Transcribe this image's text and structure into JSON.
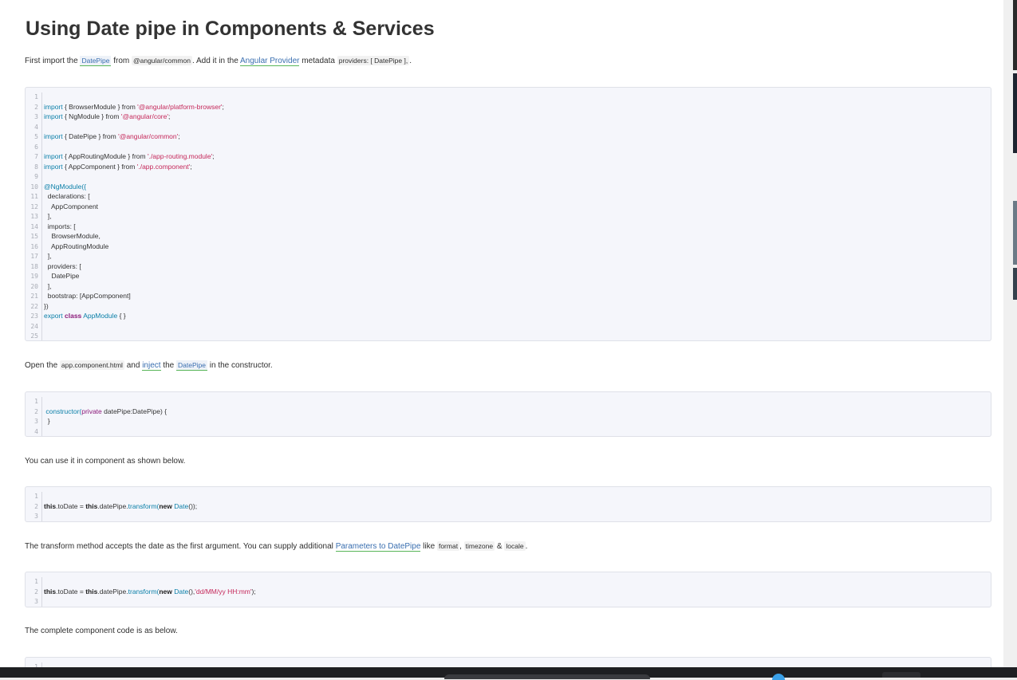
{
  "article": {
    "title": "Using Date pipe in Components & Services",
    "p1": {
      "t1": "First import the ",
      "link1": "DatePipe",
      "t2": " from ",
      "code1": "@angular/common",
      "t3": ". Add it in the ",
      "link2": "Angular Provider",
      "t4": " metadata ",
      "code2": "providers: [ DatePipe ],",
      "t5": "."
    },
    "p2": {
      "t1": "Open the ",
      "code1": "app.component.html",
      "t2": " and ",
      "link1": "inject",
      "t3": " the ",
      "link2": "DatePipe",
      "t4": " in the constructor."
    },
    "p3": {
      "t1": "You can use it in component as shown below."
    },
    "p4": {
      "t1": "The transform method accepts the date as the first argument. You can supply additional ",
      "link1": "Parameters to DatePipe",
      "t2": " like ",
      "code1": "format",
      "t3": ", ",
      "code2": "timezone",
      "t4": " & ",
      "code3": "locale",
      "t5": "."
    },
    "p5": {
      "t1": "The complete component code is as below."
    }
  },
  "code1": {
    "line_numbers": [
      "1",
      "2",
      "3",
      "4",
      "5",
      "6",
      "7",
      "8",
      "9",
      "10",
      "11",
      "12",
      "13",
      "14",
      "15",
      "16",
      "17",
      "18",
      "19",
      "20",
      "21",
      "22",
      "23",
      "24",
      "25"
    ],
    "l2": {
      "kw": "import",
      "a": " { BrowserModule } from ",
      "s": "'@angular/platform-browser'",
      "e": ";"
    },
    "l3": {
      "kw": "import",
      "a": " { NgModule } from ",
      "s": "'@angular/core'",
      "e": ";"
    },
    "l5": {
      "kw": "import",
      "a": " { DatePipe } from ",
      "s": "'@angular/common'",
      "e": ";"
    },
    "l7": {
      "kw": "import",
      "a": " { AppRoutingModule } from ",
      "s": "'./app-routing.module'",
      "e": ";"
    },
    "l8": {
      "kw": "import",
      "a": " { AppComponent } from ",
      "s": "'./app.component'",
      "e": ";"
    },
    "l10": {
      "kw": "@NgModule({"
    },
    "l11": "  declarations: [",
    "l12": "    AppComponent",
    "l13": "  ],",
    "l14": "  imports: [",
    "l15": "    BrowserModule,",
    "l16": "    AppRoutingModule",
    "l17": "  ],",
    "l18": "  providers: [",
    "l19": "    DatePipe",
    "l20": "  ],",
    "l21": "  bootstrap: [AppComponent]",
    "l22": "})",
    "l23": {
      "kw": "export",
      "b": "class",
      "n": "AppModule",
      "e": " { }"
    }
  },
  "code2": {
    "line_numbers": [
      "1",
      "2",
      "3",
      "4"
    ],
    "l2": {
      "fn": "constructor(",
      "kw": "private",
      "a": " datePipe:DatePipe) {"
    },
    "l3": "  }"
  },
  "code3": {
    "line_numbers": [
      "1",
      "2",
      "3"
    ],
    "l2": {
      "b1": "this",
      "a": ".toDate = ",
      "b2": "this",
      "c": ".datePipe.",
      "fn": "transform(",
      "b3": "new",
      "d": " ",
      "fn2": "Date",
      "e": "());"
    }
  },
  "code4": {
    "line_numbers": [
      "1",
      "2",
      "3"
    ],
    "l2": {
      "b1": "this",
      "a": ".toDate = ",
      "b2": "this",
      "c": ".datePipe.",
      "fn": "transform(",
      "b3": "new",
      "d": " ",
      "fn2": "Date",
      "e": "(),",
      "s": "'dd/MM/yy HH:mm'",
      "f": ");"
    }
  },
  "code5": {
    "line_numbers": [
      "1"
    ]
  }
}
